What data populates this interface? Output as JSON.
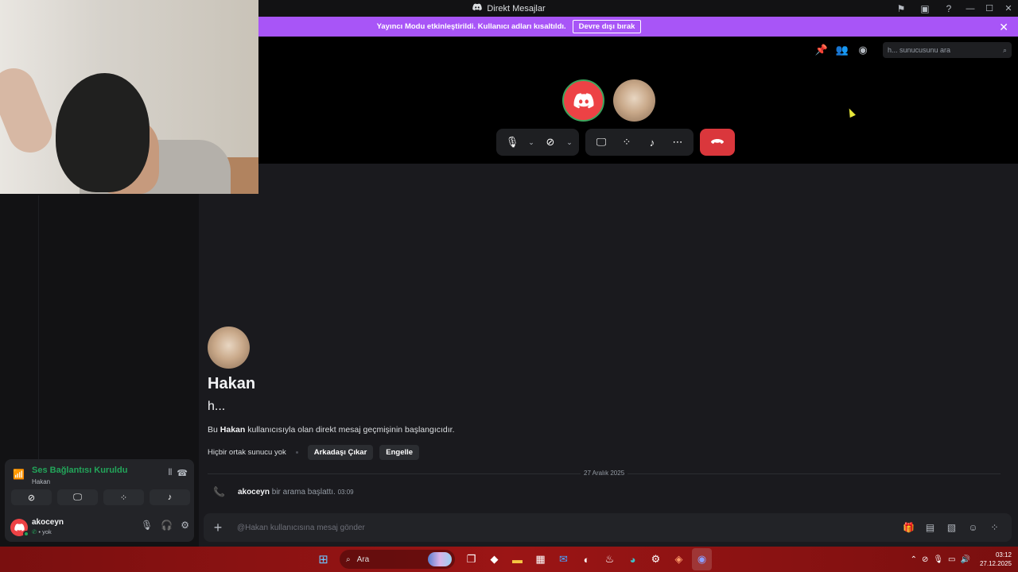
{
  "window": {
    "title": "Direkt Mesajlar",
    "controls": [
      "minimize",
      "maximize",
      "close"
    ]
  },
  "banner": {
    "message": "Yayıncı Modu etkinleştirildi. Kullanıcı adları kısaltıldı.",
    "button": "Devre dışı bırak"
  },
  "call": {
    "search_placeholder": "h... sunucusunu ara",
    "participants": [
      "akoceyn",
      "Hakan"
    ],
    "colors": {
      "hangup": "#da373c",
      "speaking_ring": "#3ba55d"
    }
  },
  "profile": {
    "name": "Hakan",
    "handle": "h...",
    "intro_prefix": "Bu ",
    "intro_name": "Hakan",
    "intro_suffix": " kullanıcısıyla olan direkt mesaj geçmişinin başlangıcıdır.",
    "mutual": "Hiçbir ortak sunucu yok",
    "remove_friend": "Arkadaşı Çıkar",
    "block": "Engelle"
  },
  "messages": {
    "date": "27 Aralık 2025",
    "call_event": {
      "user": "akoceyn",
      "text": "bir arama başlattı.",
      "time": "03:09"
    }
  },
  "composer": {
    "placeholder": "@Hakan kullanıcısına mesaj gönder"
  },
  "voice": {
    "status": "Ses Bağlantısı Kuruldu",
    "channel": "Hakan",
    "status_color": "#23a55a"
  },
  "user": {
    "name": "akoceyn",
    "state": "• yok"
  },
  "taskbar": {
    "search": "Ara",
    "time": "03:12",
    "date": "27.12.2025"
  }
}
